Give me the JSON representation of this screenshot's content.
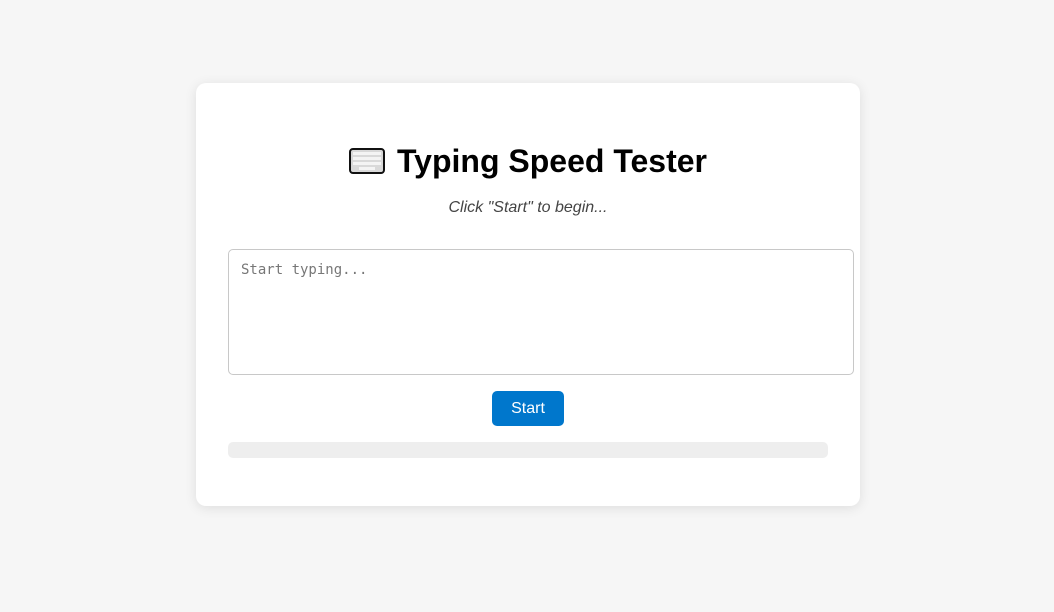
{
  "header": {
    "icon": "keyboard-icon",
    "title": "Typing Speed Tester",
    "subtitle": "Click \"Start\" to begin..."
  },
  "typing_area": {
    "value": "",
    "placeholder": "Start typing..."
  },
  "controls": {
    "start_label": "Start"
  },
  "progress": {
    "fraction": 0
  },
  "colors": {
    "accent": "#0077cc",
    "page_background": "#f6f6f6",
    "card_background": "#ffffff",
    "progress_track": "#eeeeee"
  }
}
